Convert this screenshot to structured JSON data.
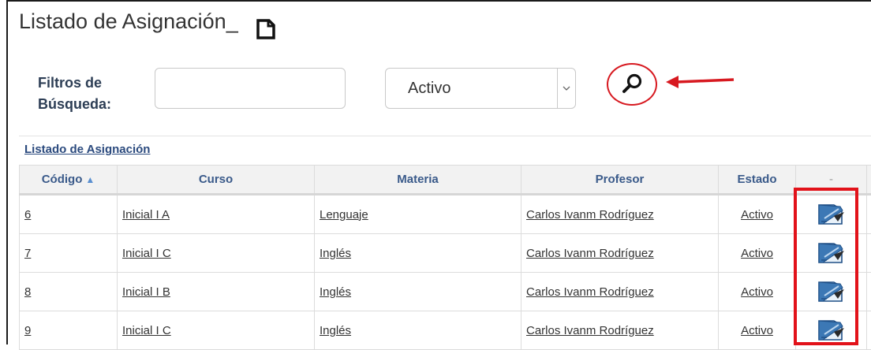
{
  "header": {
    "title": "Listado de Asignación_",
    "new_icon": "new-document-icon"
  },
  "filters": {
    "label_line1": "Filtros de",
    "label_line2": "Búsqueda:",
    "text_value": "",
    "status_selected": "Activo"
  },
  "table": {
    "caption": "Listado de Asignación",
    "columns": [
      "Código",
      "Curso",
      "Materia",
      "Profesor",
      "Estado",
      "-"
    ],
    "rows": [
      {
        "codigo": "6",
        "curso": "Inicial I A",
        "materia": "Lenguaje",
        "profesor": "Carlos Ivanm Rodríguez",
        "estado": "Activo"
      },
      {
        "codigo": "7",
        "curso": "Inicial I C",
        "materia": "Inglés",
        "profesor": "Carlos Ivanm Rodríguez",
        "estado": "Activo"
      },
      {
        "codigo": "8",
        "curso": "Inicial I B",
        "materia": "Inglés",
        "profesor": "Carlos Ivanm Rodríguez",
        "estado": "Activo"
      },
      {
        "codigo": "9",
        "curso": "Inicial I C",
        "materia": "Inglés",
        "profesor": "Carlos Ivanm Rodríguez",
        "estado": "Activo"
      }
    ]
  },
  "colors": {
    "annotation": "#d71920",
    "header_text": "#3a5a8a",
    "caption": "#2b4a7e"
  }
}
